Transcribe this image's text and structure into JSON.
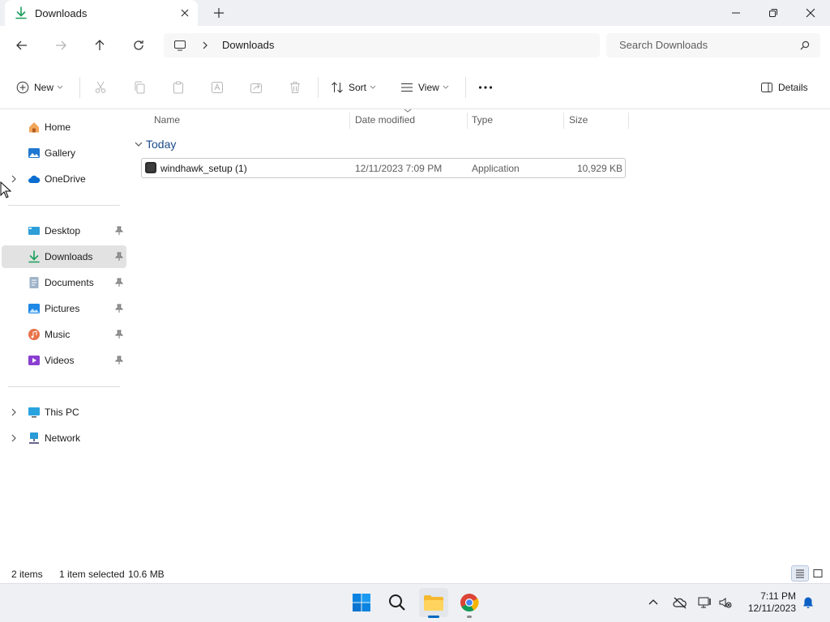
{
  "tab": {
    "title": "Downloads",
    "close_icon": "close-icon",
    "new_tab_icon": "plus-icon"
  },
  "window": {
    "minimize": "minimize-icon",
    "maximize": "restore-icon",
    "close": "close-icon"
  },
  "address": {
    "path": "Downloads",
    "root_icon": "pc-monitor-icon"
  },
  "search": {
    "placeholder": "Search Downloads"
  },
  "commands": {
    "new_label": "New",
    "sort_label": "Sort",
    "view_label": "View",
    "details_label": "Details"
  },
  "sidebar": {
    "items": [
      {
        "label": "Home",
        "icon": "home-icon"
      },
      {
        "label": "Gallery",
        "icon": "gallery-icon"
      },
      {
        "label": "OneDrive",
        "icon": "cloud-icon"
      },
      {
        "label": "Desktop",
        "icon": "desktop-icon"
      },
      {
        "label": "Downloads",
        "icon": "download-icon",
        "selected": true
      },
      {
        "label": "Documents",
        "icon": "document-icon"
      },
      {
        "label": "Pictures",
        "icon": "pictures-icon"
      },
      {
        "label": "Music",
        "icon": "music-icon"
      },
      {
        "label": "Videos",
        "icon": "video-icon"
      },
      {
        "label": "This PC",
        "icon": "pc-icon"
      },
      {
        "label": "Network",
        "icon": "network-icon"
      }
    ]
  },
  "columns": {
    "name": "Name",
    "date": "Date modified",
    "type": "Type",
    "size": "Size"
  },
  "group": {
    "label": "Today"
  },
  "files": [
    {
      "name": "windhawk_setup (1)",
      "date": "12/11/2023 7:09 PM",
      "type": "Application",
      "size": "10,929 KB"
    }
  ],
  "status": {
    "items": "2 items",
    "selected": "1 item selected",
    "size": "10.6 MB"
  },
  "clock": {
    "time": "7:11 PM",
    "date": "12/11/2023"
  },
  "colors": {
    "accent": "#0067c0",
    "selected_bg": "#e2e2e2"
  }
}
